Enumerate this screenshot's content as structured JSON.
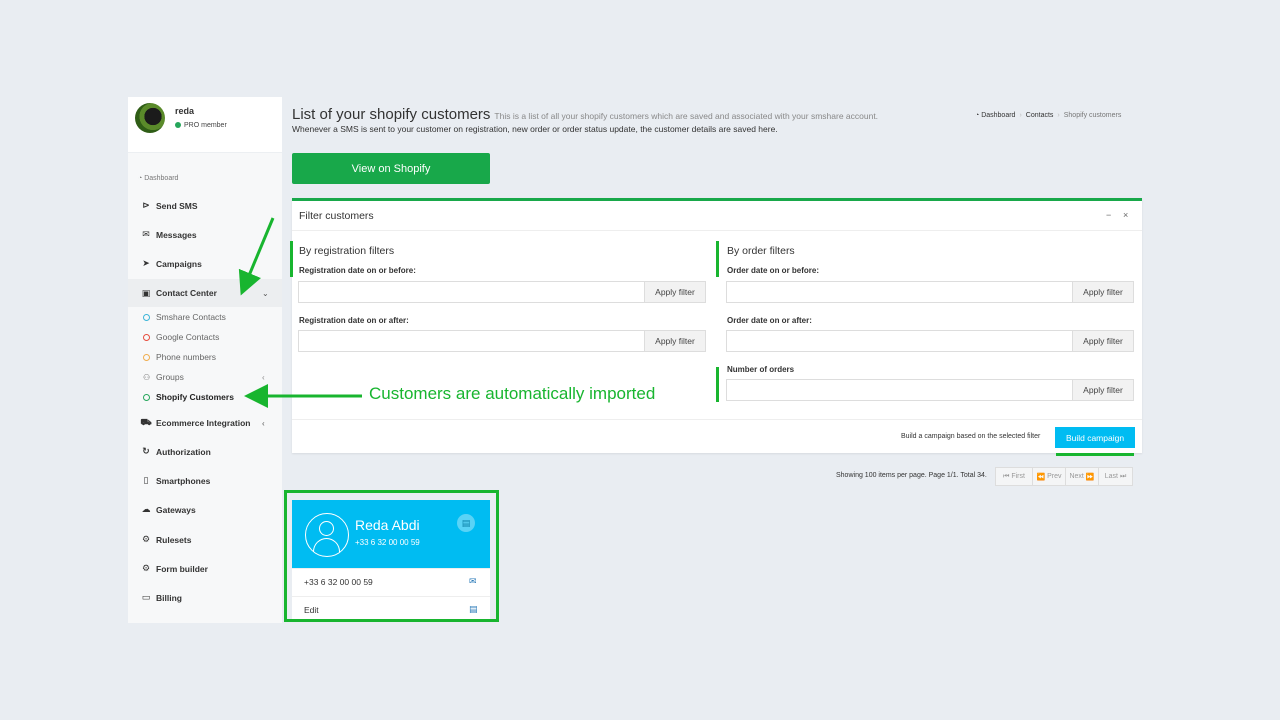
{
  "sidebar": {
    "user_name": "reda",
    "user_status": "PRO member",
    "nav_header": "Dashboard",
    "items": [
      {
        "label": "Send SMS",
        "icon": "paper-plane-icon"
      },
      {
        "label": "Messages",
        "icon": "envelope-icon"
      },
      {
        "label": "Campaigns",
        "icon": "send-icon"
      },
      {
        "label": "Contact Center",
        "icon": "contact-book-icon"
      },
      {
        "label": "Ecommerce Integration",
        "icon": "cart-icon"
      },
      {
        "label": "Authorization",
        "icon": "refresh-icon"
      },
      {
        "label": "Smartphones",
        "icon": "mobile-icon"
      },
      {
        "label": "Gateways",
        "icon": "cloud-icon"
      },
      {
        "label": "Rulesets",
        "icon": "gears-icon"
      },
      {
        "label": "Form builder",
        "icon": "cogs-icon"
      },
      {
        "label": "Billing",
        "icon": "money-icon"
      }
    ],
    "sub_items": [
      {
        "label": "Smshare Contacts",
        "color": "#3bb5d8"
      },
      {
        "label": "Google Contacts",
        "color": "#e74c3c"
      },
      {
        "label": "Phone numbers",
        "color": "#f0ad4e"
      },
      {
        "label": "Groups",
        "color": "#888888"
      },
      {
        "label": "Shopify Customers",
        "color": "#26a65b"
      }
    ]
  },
  "header": {
    "title": "List of your shopify customers",
    "subtitle": "This is a list of all your shopify customers which are saved and associated with your smshare account.",
    "description": "Whenever a SMS is sent to your customer on registration, new order or order status update, the customer details are saved here.",
    "breadcrumb": [
      "Dashboard",
      "Contacts",
      "Shopify customers"
    ]
  },
  "shopify_button": "View on Shopify",
  "filter_panel": {
    "title": "Filter customers",
    "minimize": "−",
    "close": "×",
    "registration": {
      "title": "By registration filters",
      "before_label": "Registration date on or before:",
      "after_label": "Registration date on or after:"
    },
    "order": {
      "title": "By order filters",
      "before_label": "Order date on or before:",
      "after_label": "Order date on or after:",
      "count_label": "Number of orders"
    },
    "apply_label": "Apply filter",
    "build_text": "Build a campaign based on the selected filter",
    "build_button": "Build campaign"
  },
  "pagination": {
    "info": "Showing 100 items per page. Page 1/1. Total 34.",
    "first": "First",
    "prev": "Prev",
    "next": "Next",
    "last": "Last"
  },
  "customer_card": {
    "name": "Reda Abdi",
    "phone": "+33 6 32 00 00 59",
    "row_phone": "+33 6 32 00 00 59",
    "edit": "Edit"
  },
  "annotation": "Customers are automatically imported",
  "colors": {
    "accent_green": "#18a84a",
    "annotation_green": "#18b52f",
    "card_blue": "#00bcf2"
  }
}
